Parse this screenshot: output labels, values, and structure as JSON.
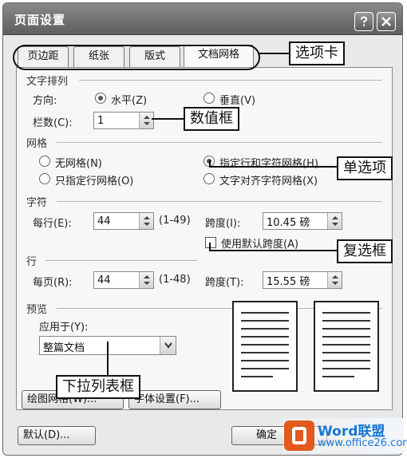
{
  "window": {
    "title": "页面设置"
  },
  "tabs": [
    {
      "label": "页边距"
    },
    {
      "label": "纸张"
    },
    {
      "label": "版式"
    },
    {
      "label": "文档网格"
    }
  ],
  "text_direction": {
    "section_title": "文字排列",
    "direction_label": "方向:",
    "horizontal_label": "水平(Z)",
    "vertical_label": "垂直(V)",
    "columns_label": "栏数(C):",
    "columns_value": "1"
  },
  "grid": {
    "section_title": "网格",
    "no_grid": "无网格(N)",
    "line_char_grid": "指定行和字符网格(H)",
    "line_only_grid": "只指定行网格(O)",
    "snap_char_grid": "文字对齐字符网格(X)"
  },
  "chars": {
    "section_title": "字符",
    "per_line_label": "每行(E):",
    "per_line_value": "44",
    "per_line_range": "(1-49)",
    "pitch_label": "跨度(I):",
    "pitch_value": "10.45 磅",
    "default_pitch": "使用默认跨度(A)"
  },
  "lines": {
    "section_title": "行",
    "per_page_label": "每页(R):",
    "per_page_value": "44",
    "per_page_range": "(1-48)",
    "pitch_label": "跨度(T):",
    "pitch_value": "15.55 磅"
  },
  "preview": {
    "section_title": "预览",
    "apply_to_label": "应用于(Y):",
    "apply_to_value": "整篇文档"
  },
  "bottom_buttons": {
    "drawing_grid": "绘图网格(W)...",
    "font_settings": "字体设置(F)...",
    "default": "默认(D)...",
    "ok": "确定"
  },
  "callouts": {
    "tabs": "选项卡",
    "spin": "数值框",
    "radio": "单选项",
    "checkbox": "复选框",
    "dropdown": "下拉列表框"
  },
  "watermark": {
    "brand": "Word联盟",
    "url": "www.office26.com"
  }
}
